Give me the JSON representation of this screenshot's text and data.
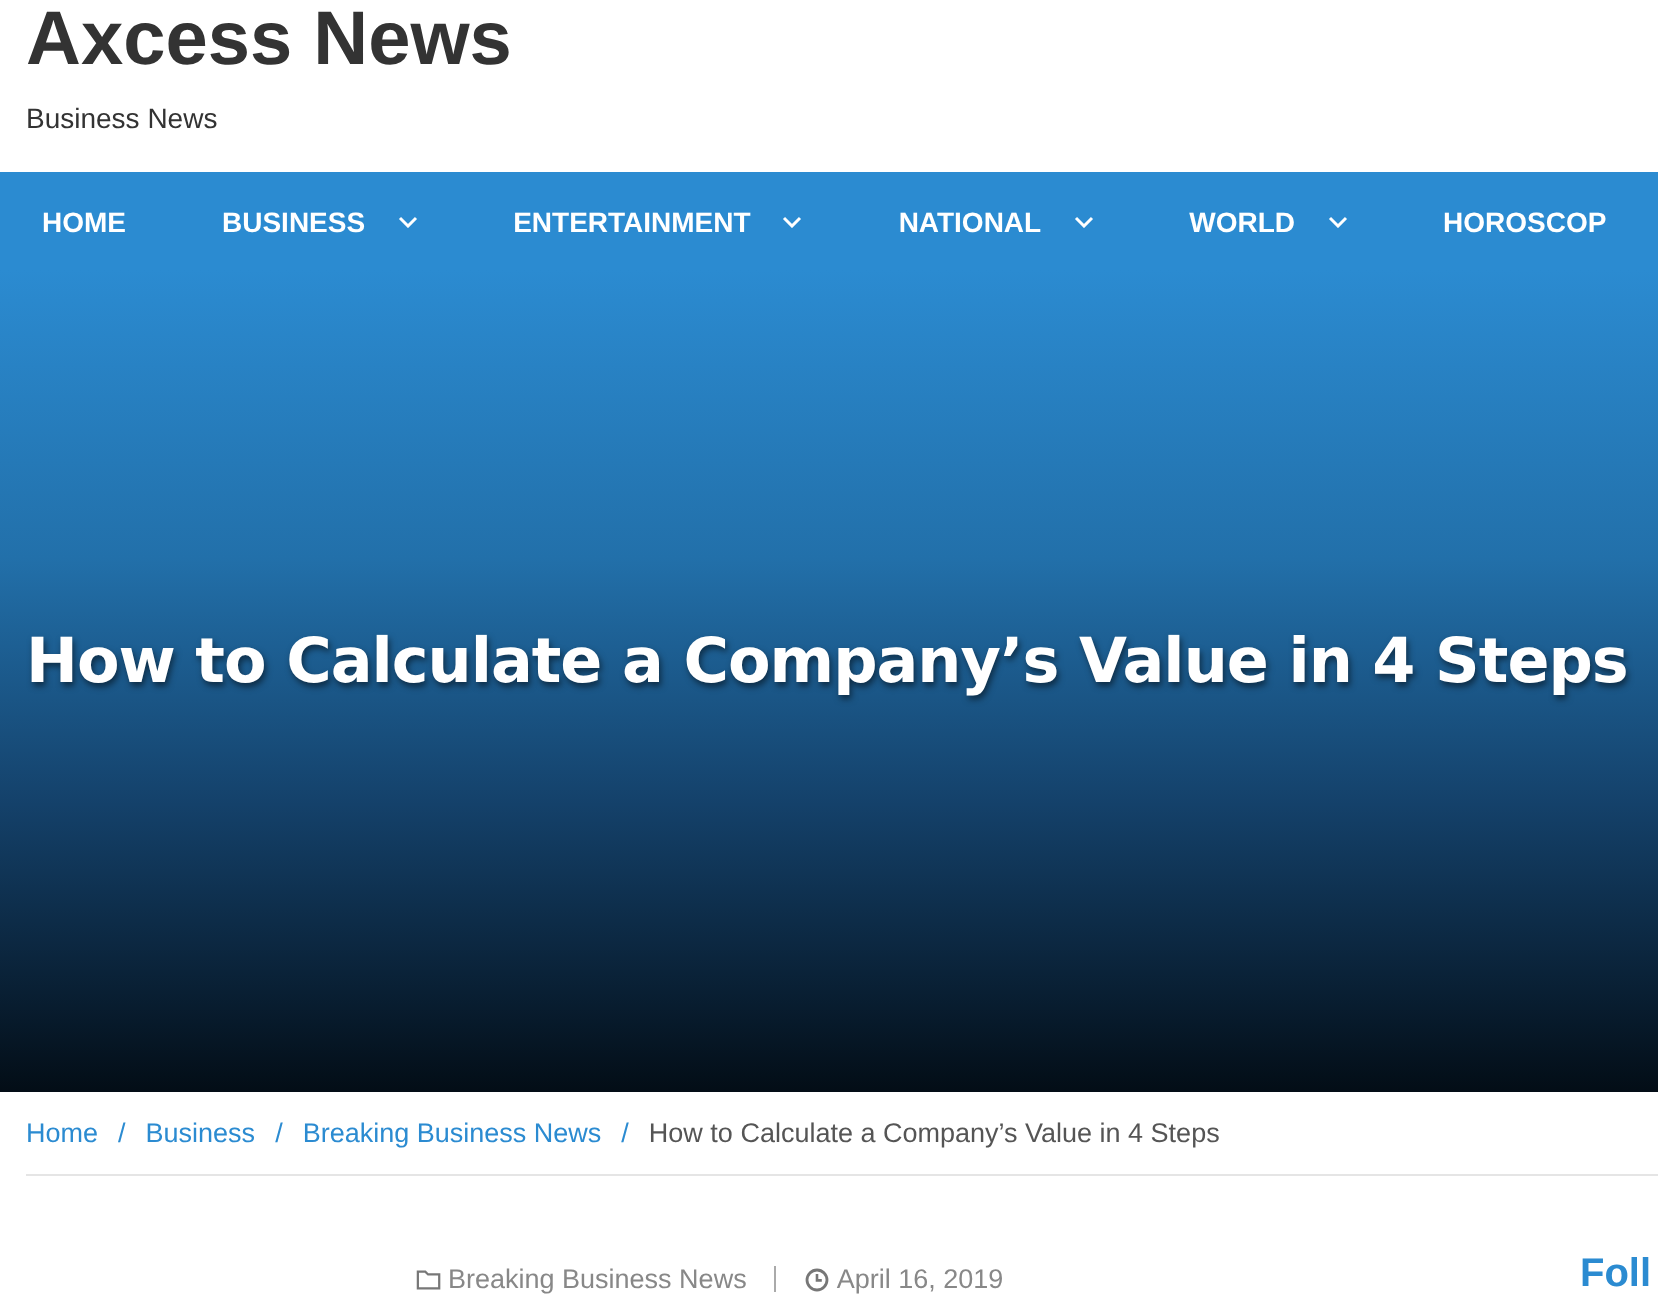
{
  "site": {
    "title": "Axcess News",
    "tagline": "Business News"
  },
  "nav": [
    {
      "label": "HOME",
      "has_submenu": false
    },
    {
      "label": "BUSINESS",
      "has_submenu": true
    },
    {
      "label": "ENTERTAINMENT",
      "has_submenu": true
    },
    {
      "label": "NATIONAL",
      "has_submenu": true
    },
    {
      "label": "WORLD",
      "has_submenu": true
    },
    {
      "label": "HOROSCOP",
      "has_submenu": false
    }
  ],
  "hero": {
    "title": "How to Calculate a Company’s Value in 4 Steps"
  },
  "breadcrumb": [
    {
      "kind": "link",
      "label": "Home"
    },
    {
      "kind": "separator",
      "label": "/"
    },
    {
      "kind": "link",
      "label": "Business"
    },
    {
      "kind": "separator",
      "label": "/"
    },
    {
      "kind": "link",
      "label": "Breaking Business News"
    },
    {
      "kind": "separator",
      "label": "/"
    },
    {
      "kind": "current",
      "label": "How to Calculate a Company’s Value in 4 Steps"
    }
  ],
  "meta": {
    "category": "Breaking Business News",
    "date": "April 16, 2019"
  },
  "sidebar": {
    "heading": "Foll"
  }
}
